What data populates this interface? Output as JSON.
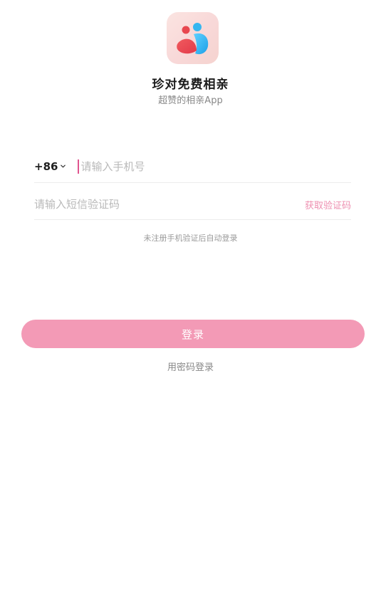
{
  "app": {
    "name": "珍对免费相亲",
    "tagline": "超赞的相亲App",
    "logo_icon": "couple-logo-icon"
  },
  "login_form": {
    "country_code": "+86",
    "phone_placeholder": "请输入手机号",
    "code_placeholder": "请输入短信验证码",
    "get_code_label": "获取验证码",
    "auto_register_note": "未注册手机验证后自动登录",
    "login_button_label": "登录",
    "password_login_label": "用密码登录"
  },
  "colors": {
    "accent": "#f39ab6",
    "link": "#ee8fb0",
    "cursor": "#e0558f",
    "logo_red": "#e8474f",
    "logo_blue": "#35b6f0"
  }
}
